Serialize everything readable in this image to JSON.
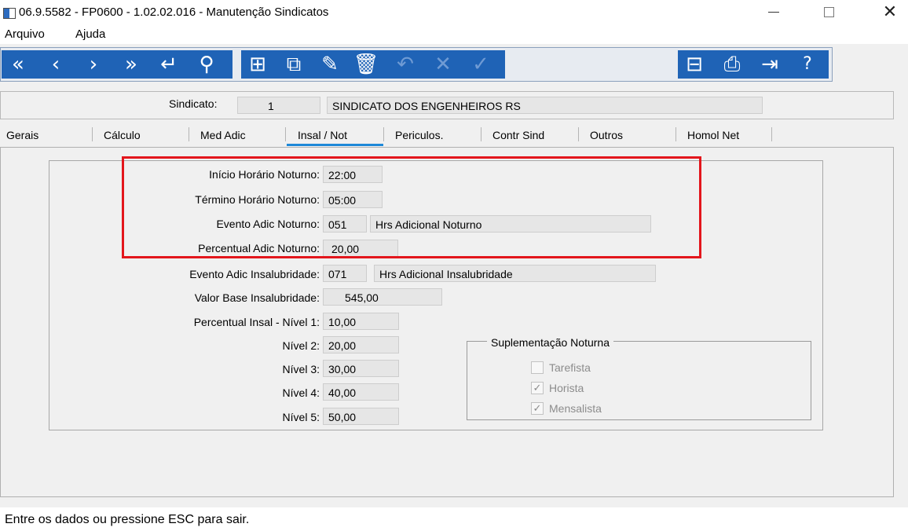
{
  "window": {
    "title": "06.9.5582 - FP0600 - 1.02.02.016 - Manutenção Sindicatos",
    "minimize_icon": "minimize-icon",
    "maximize_icon": "maximize-icon",
    "close_glyph": "✕"
  },
  "menu": {
    "items": [
      "Arquivo",
      "Ajuda"
    ]
  },
  "toolbar": {
    "nav": [
      {
        "icon": "first-record-icon",
        "glyph": "«"
      },
      {
        "icon": "previous-record-icon",
        "glyph": "‹"
      },
      {
        "icon": "next-record-icon",
        "glyph": "›"
      },
      {
        "icon": "last-record-icon",
        "glyph": "»"
      },
      {
        "icon": "return-icon",
        "glyph": "↵"
      },
      {
        "icon": "search-icon",
        "glyph": "⚲"
      }
    ],
    "edit": [
      {
        "icon": "new-record-icon",
        "glyph": "⊞"
      },
      {
        "icon": "copy-record-icon",
        "glyph": "⧉"
      },
      {
        "icon": "edit-record-icon",
        "glyph": "✎"
      },
      {
        "icon": "delete-icon",
        "glyph": "🗑"
      },
      {
        "icon": "undo-icon",
        "glyph": "↶",
        "disabled": true
      },
      {
        "icon": "cancel-icon",
        "glyph": "✕",
        "disabled": true
      },
      {
        "icon": "confirm-icon",
        "glyph": "✓",
        "disabled": true
      }
    ],
    "tools": [
      {
        "icon": "tree-icon",
        "glyph": "⊟"
      },
      {
        "icon": "print-icon",
        "glyph": "⎙"
      },
      {
        "icon": "exit-icon",
        "glyph": "⇥"
      },
      {
        "icon": "help-icon",
        "glyph": "?"
      }
    ]
  },
  "sindicato": {
    "label": "Sindicato:",
    "code": "1",
    "name": "SINDICATO DOS ENGENHEIROS RS"
  },
  "tabs": [
    {
      "label": "Gerais"
    },
    {
      "label": "Cálculo"
    },
    {
      "label": "Med Adic"
    },
    {
      "label": "Insal / Not",
      "active": true
    },
    {
      "label": "Periculos."
    },
    {
      "label": "Contr Sind"
    },
    {
      "label": "Outros"
    },
    {
      "label": "Homol Net"
    }
  ],
  "form": {
    "inicio_noturno": {
      "label": "Início Horário Noturno:",
      "value": "22:00"
    },
    "termino_noturno": {
      "label": "Término Horário Noturno:",
      "value": "05:00"
    },
    "evento_noturno": {
      "label": "Evento Adic Noturno:",
      "code": "051",
      "desc": "Hrs Adicional Noturno"
    },
    "percentual_noturno": {
      "label": "Percentual Adic Noturno:",
      "value": "20,00"
    },
    "evento_insal": {
      "label": "Evento Adic Insalubridade:",
      "code": "071",
      "desc": "Hrs Adicional Insalubridade"
    },
    "valor_base_insal": {
      "label": "Valor Base Insalubridade:",
      "value": "545,00"
    },
    "nivel1": {
      "label": "Percentual Insal - Nível 1:",
      "value": "10,00"
    },
    "nivel2": {
      "label": "Nível 2:",
      "value": "20,00"
    },
    "nivel3": {
      "label": "Nível 3:",
      "value": "30,00"
    },
    "nivel4": {
      "label": "Nível 4:",
      "value": "40,00"
    },
    "nivel5": {
      "label": "Nível 5:",
      "value": "50,00"
    }
  },
  "suplementacao": {
    "title": "Suplementação Noturna",
    "options": [
      {
        "label": "Tarefista",
        "checked": false,
        "mark": ""
      },
      {
        "label": "Horista",
        "checked": true,
        "mark": "✓"
      },
      {
        "label": "Mensalista",
        "checked": true,
        "mark": "✓"
      }
    ]
  },
  "status": {
    "text": "Entre os dados ou pressione ESC para sair."
  },
  "colors": {
    "toolbar_blue": "#1f63b6",
    "highlight_red": "#e3161c",
    "tab_active": "#1e88d8"
  }
}
